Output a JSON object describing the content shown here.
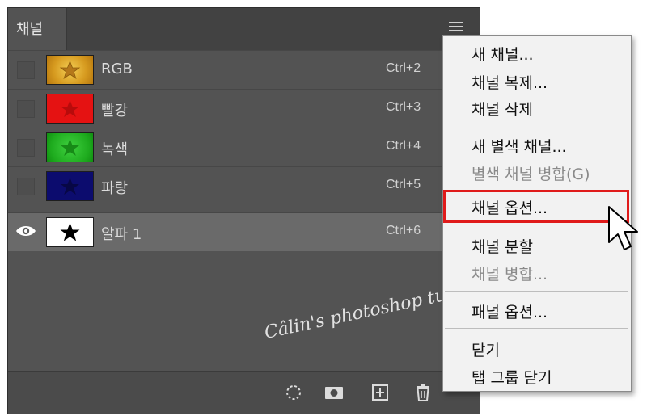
{
  "panel": {
    "tab_label": "채널",
    "channels": [
      {
        "name": "RGB",
        "shortcut": "Ctrl+2",
        "thumb_color": "#d79a1e",
        "visible": false
      },
      {
        "name": "빨강",
        "shortcut": "Ctrl+3",
        "thumb_color": "#e51212",
        "visible": false
      },
      {
        "name": "녹색",
        "shortcut": "Ctrl+4",
        "thumb_color": "#21b521",
        "visible": false
      },
      {
        "name": "파랑",
        "shortcut": "Ctrl+5",
        "thumb_color": "#0c0c6e",
        "visible": false
      },
      {
        "name": "알파 1",
        "shortcut": "Ctrl+6",
        "thumb_color": "#ffffff",
        "visible": true,
        "selected": true
      }
    ],
    "bottom_icons": [
      "selection-icon",
      "mask-icon",
      "new-channel-icon",
      "trash-icon"
    ]
  },
  "menu": {
    "items": [
      {
        "label": "새 채널...",
        "enabled": true
      },
      {
        "label": "채널 복제...",
        "enabled": true
      },
      {
        "label": "채널 삭제",
        "enabled": true
      },
      {
        "label": "새 별색 채널...",
        "enabled": true
      },
      {
        "label": "별색 채널 병합(G)",
        "enabled": false
      },
      {
        "label": "채널 옵션...",
        "enabled": true,
        "highlighted": true
      },
      {
        "label": "채널 분할",
        "enabled": true
      },
      {
        "label": "채널 병합...",
        "enabled": false
      },
      {
        "label": "패널 옵션...",
        "enabled": true
      },
      {
        "label": "닫기",
        "enabled": true
      },
      {
        "label": "탭 그룹 닫기",
        "enabled": true
      }
    ]
  },
  "watermark": "Câlin's photoshop tutorial",
  "colors": {
    "highlight_border": "#e01b1b",
    "panel_bg": "#535353",
    "menu_bg": "#f2f2f2"
  }
}
